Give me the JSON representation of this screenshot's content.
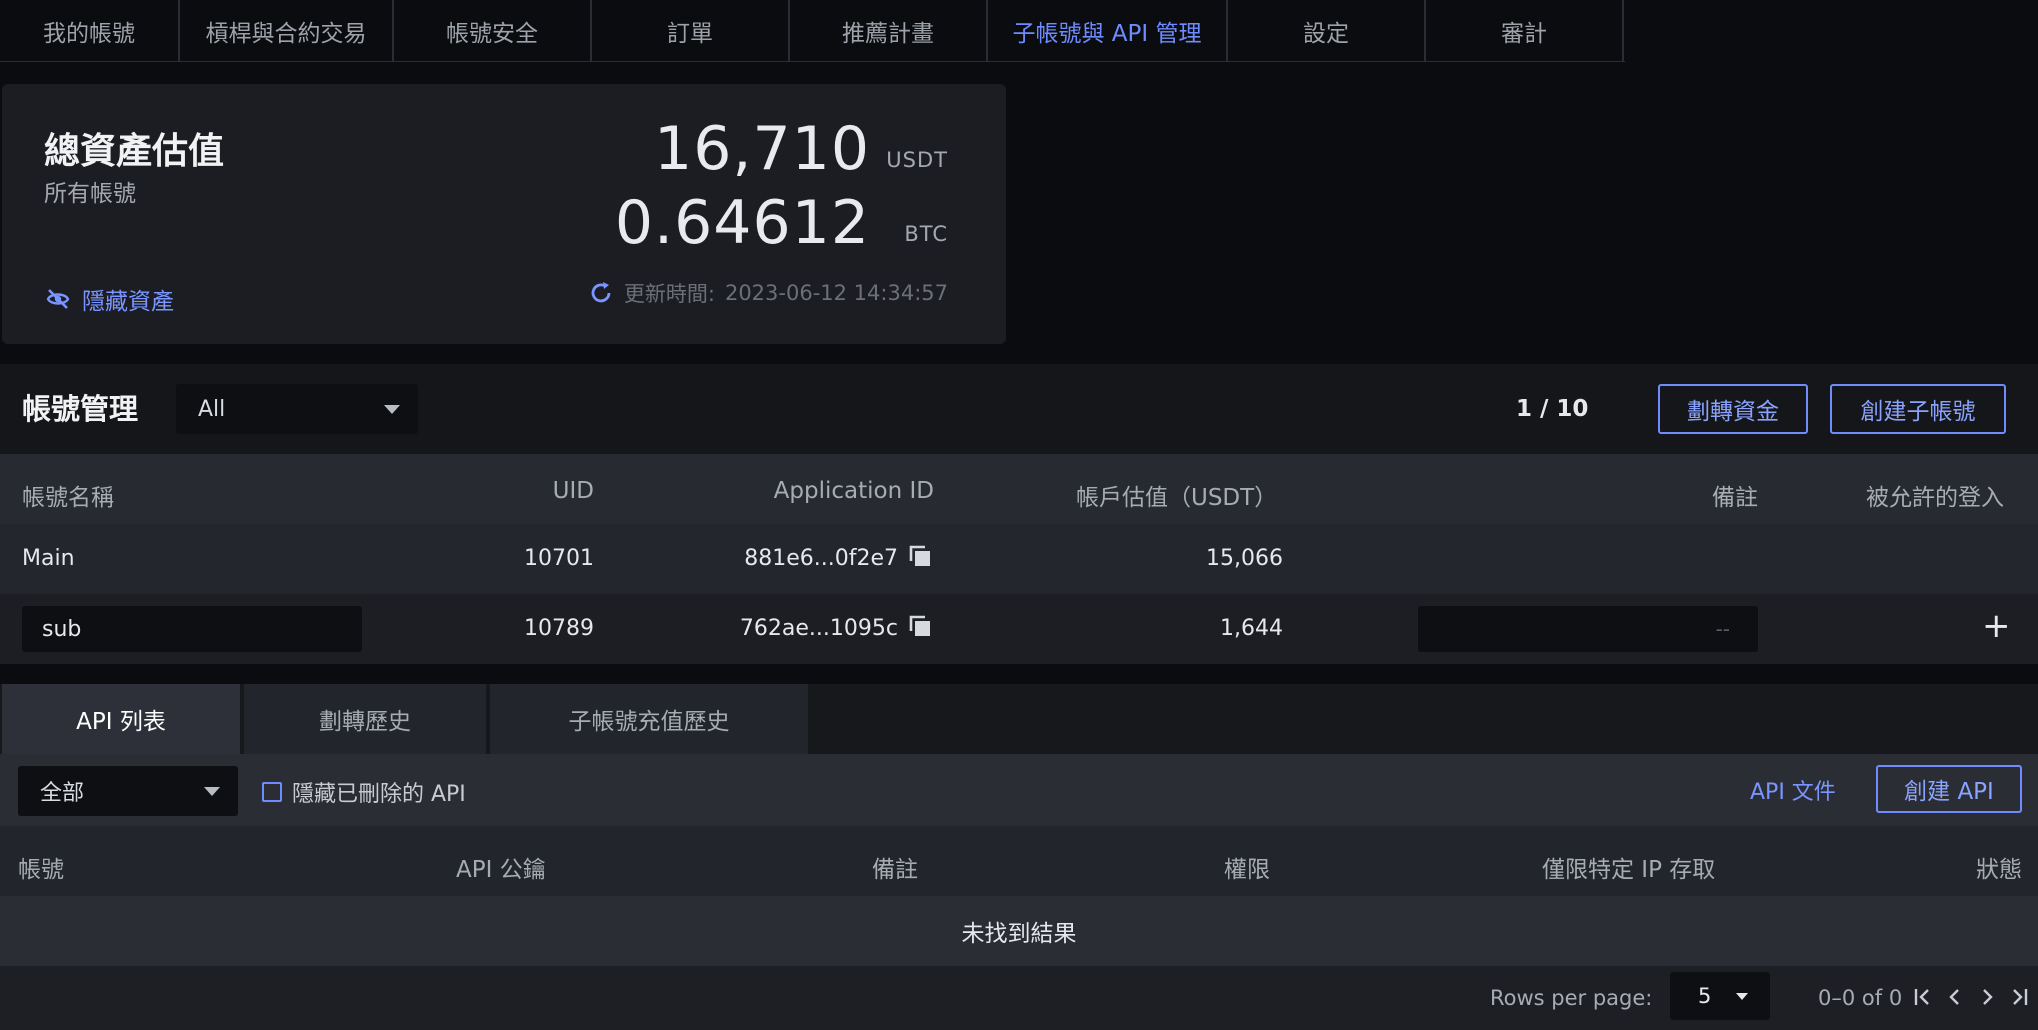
{
  "nav": {
    "tabs": [
      {
        "label": "我的帳號"
      },
      {
        "label": "槓桿與合約交易"
      },
      {
        "label": "帳號安全"
      },
      {
        "label": "訂單"
      },
      {
        "label": "推薦計畫"
      },
      {
        "label": "子帳號與 API 管理"
      },
      {
        "label": "設定"
      },
      {
        "label": "審計"
      }
    ],
    "active_index": 5
  },
  "assets": {
    "title": "總資產估值",
    "subtitle": "所有帳號",
    "usdt_amount": "16,710",
    "usdt_unit": "USDT",
    "btc_amount": "0.64612",
    "btc_unit": "BTC",
    "hide_label": "隱藏資產",
    "update_label": "更新時間:",
    "update_time": "2023-06-12 14:34:57"
  },
  "accounts": {
    "title": "帳號管理",
    "filter_value": "All",
    "page_count": "1 / 10",
    "transfer_button": "劃轉資金",
    "create_button": "創建子帳號",
    "columns": {
      "name": "帳號名稱",
      "uid": "UID",
      "app_id": "Application ID",
      "value": "帳戶估值（USDT）",
      "note": "備註",
      "login": "被允許的登入"
    },
    "rows": [
      {
        "name": "Main",
        "uid": "10701",
        "app_id": "881e6...0f2e7",
        "value": "15,066",
        "note": ""
      },
      {
        "name": "sub",
        "uid": "10789",
        "app_id": "762ae...1095c",
        "value": "1,644",
        "note": "--"
      }
    ],
    "add_symbol": "+"
  },
  "api": {
    "tabs": [
      {
        "label": "API 列表"
      },
      {
        "label": "劃轉歷史"
      },
      {
        "label": "子帳號充值歷史"
      }
    ],
    "filter_value": "全部",
    "hide_deleted_label": "隱藏已刪除的 API",
    "doc_link": "API 文件",
    "create_button": "創建 API",
    "columns": {
      "account": "帳號",
      "pubkey": "API 公鑰",
      "note": "備註",
      "permission": "權限",
      "ip": "僅限特定 IP 存取",
      "status": "狀態"
    },
    "empty_text": "未找到結果",
    "rows_per_page_label": "Rows per page:",
    "rows_per_page": "5",
    "range_text": "0–0 of 0"
  },
  "colors": {
    "accent": "#6f8cff",
    "background": "#0b0c0f",
    "card": "#1b1d22"
  }
}
